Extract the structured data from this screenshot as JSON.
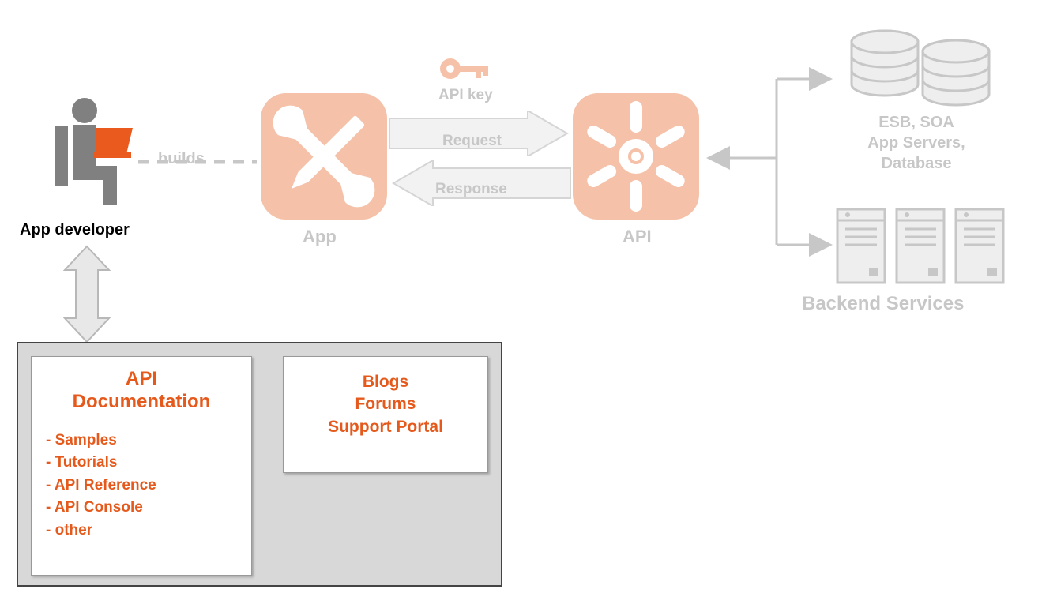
{
  "developer": {
    "label": "App developer"
  },
  "builds": {
    "label": "builds"
  },
  "app": {
    "label": "App"
  },
  "flow": {
    "api_key": "API key",
    "request": "Request",
    "response": "Response"
  },
  "api": {
    "label": "API"
  },
  "backend": {
    "top_line1": "ESB, SOA",
    "top_line2": "App Servers,",
    "top_line3": "Database",
    "services": "Backend Services"
  },
  "doc_left": {
    "title_line1": "API",
    "title_line2": "Documentation",
    "items": [
      "- Samples",
      "- Tutorials",
      "- API Reference",
      "- API Console",
      "- other"
    ]
  },
  "doc_right": {
    "line1": "Blogs",
    "line2": "Forums",
    "line3": "Support Portal"
  },
  "colors": {
    "orange": "#e55a1c",
    "faded_orange": "#f5c1a8",
    "gray": "#c7c7c7",
    "light_gray": "#e8e8e8"
  }
}
